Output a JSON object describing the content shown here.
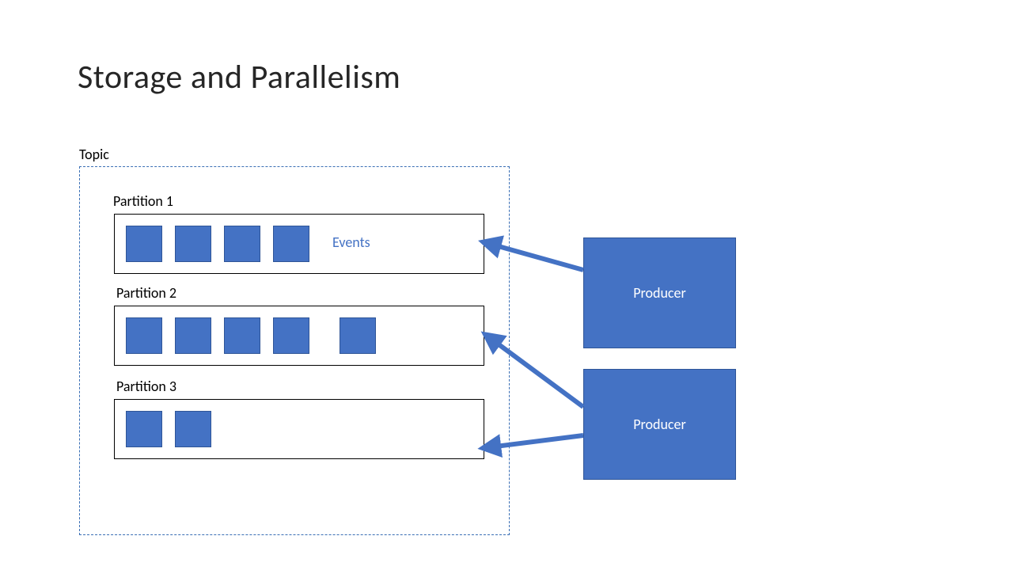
{
  "title": "Storage and Parallelism",
  "topic_label": "Topic",
  "partitions": [
    {
      "label": "Partition 1",
      "event_count": 4
    },
    {
      "label": "Partition 2",
      "event_count": 5
    },
    {
      "label": "Partition 3",
      "event_count": 2
    }
  ],
  "events_label": "Events",
  "producers": [
    {
      "label": "Producer"
    },
    {
      "label": "Producer"
    }
  ],
  "colors": {
    "box_fill": "#4472c4",
    "box_border": "#2f5597",
    "events_text": "#4472c4",
    "topic_border": "#3a6fb5"
  }
}
